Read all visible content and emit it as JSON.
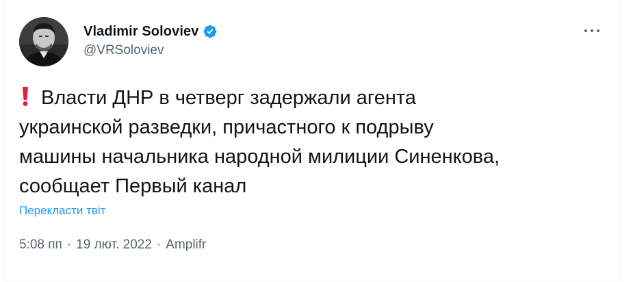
{
  "author": {
    "display_name": "Vladimir Soloviev",
    "handle": "@VRSoloviev",
    "verified": true
  },
  "tweet": {
    "emoji": "❗",
    "lines": [
      "Власти ДНР в четверг задержали агента",
      "украинской разведки, причастного к подрыву",
      "машины начальника народной милиции Синенкова,",
      "сообщает Первый канал"
    ],
    "translate_label": "Перекласти твіт",
    "time": "5:08 пп",
    "date": "19 лют. 2022",
    "source": "Amplifr",
    "separator": "·"
  },
  "colors": {
    "accent": "#1d9bf0",
    "secondary_text": "#536471",
    "exclaim_red": "#e0223a"
  },
  "icons": {
    "verified": "verified-badge-icon",
    "more": "more-options-icon"
  }
}
